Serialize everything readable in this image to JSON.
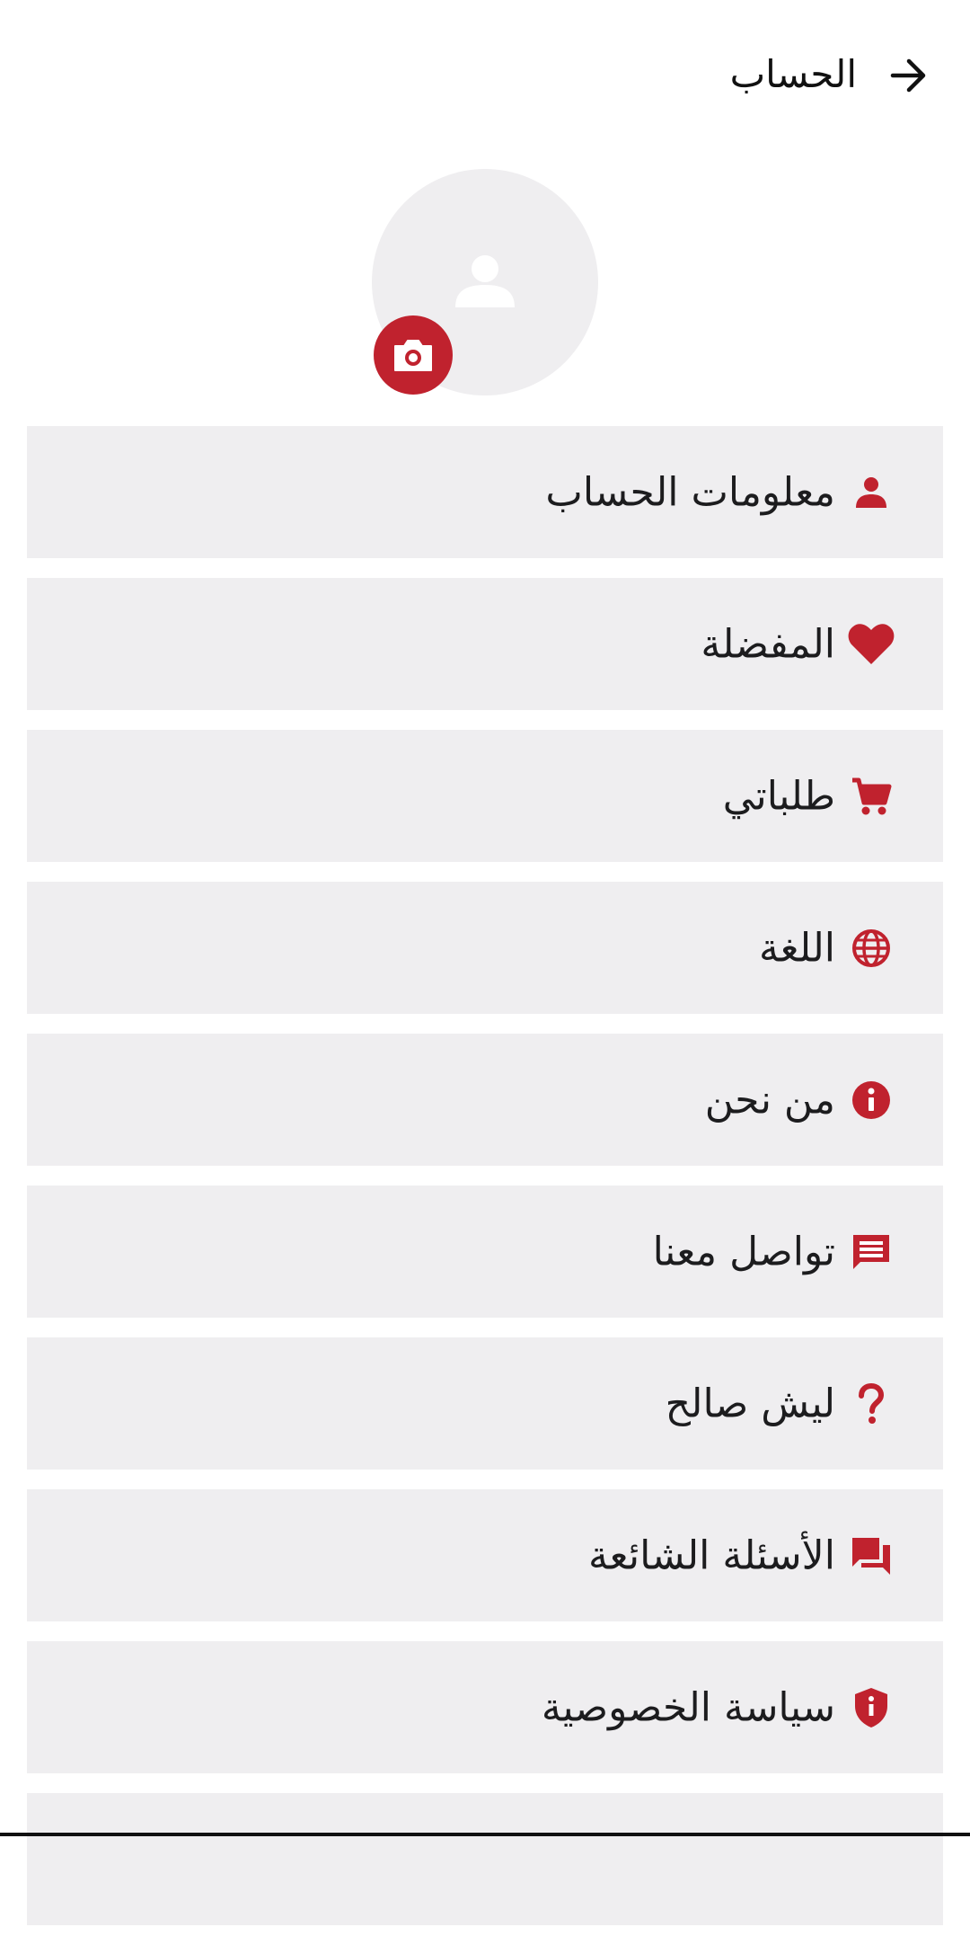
{
  "header": {
    "title": "الحساب",
    "back_icon": "arrow-right-icon"
  },
  "profile": {
    "avatar_icon": "person-icon",
    "camera_icon": "camera-icon"
  },
  "colors": {
    "accent": "#c0222e",
    "row_background": "#efeef0",
    "text": "#1c1c1e"
  },
  "menu": {
    "items": [
      {
        "label": "معلومات الحساب",
        "icon": "person-icon"
      },
      {
        "label": "المفضلة",
        "icon": "heart-icon"
      },
      {
        "label": "طلباتي",
        "icon": "cart-icon"
      },
      {
        "label": "اللغة",
        "icon": "globe-icon"
      },
      {
        "label": "من نحن",
        "icon": "info-icon"
      },
      {
        "label": "تواصل معنا",
        "icon": "message-icon"
      },
      {
        "label": "ليش صالح",
        "icon": "question-icon"
      },
      {
        "label": "الأسئلة الشائعة",
        "icon": "forum-icon"
      },
      {
        "label": "سياسة الخصوصية",
        "icon": "shield-icon"
      },
      {
        "label": "",
        "icon": ""
      }
    ]
  }
}
